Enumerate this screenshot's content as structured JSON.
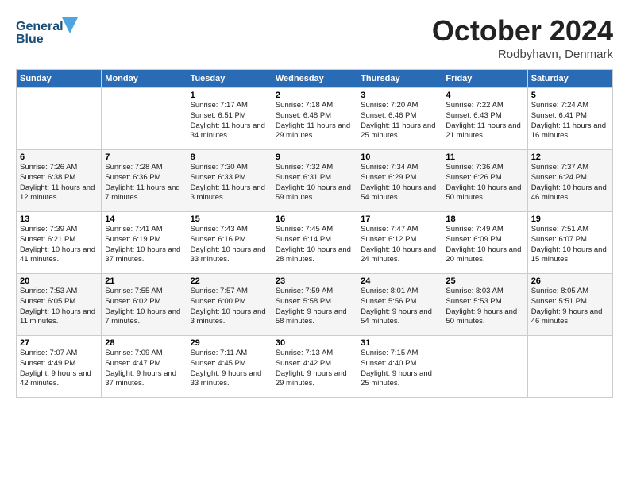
{
  "header": {
    "logo_line1": "General",
    "logo_line2": "Blue",
    "month": "October 2024",
    "location": "Rodbyhavn, Denmark"
  },
  "days_of_week": [
    "Sunday",
    "Monday",
    "Tuesday",
    "Wednesday",
    "Thursday",
    "Friday",
    "Saturday"
  ],
  "weeks": [
    [
      {
        "day": "",
        "sunrise": "",
        "sunset": "",
        "daylight": ""
      },
      {
        "day": "",
        "sunrise": "",
        "sunset": "",
        "daylight": ""
      },
      {
        "day": "1",
        "sunrise": "Sunrise: 7:17 AM",
        "sunset": "Sunset: 6:51 PM",
        "daylight": "Daylight: 11 hours and 34 minutes."
      },
      {
        "day": "2",
        "sunrise": "Sunrise: 7:18 AM",
        "sunset": "Sunset: 6:48 PM",
        "daylight": "Daylight: 11 hours and 29 minutes."
      },
      {
        "day": "3",
        "sunrise": "Sunrise: 7:20 AM",
        "sunset": "Sunset: 6:46 PM",
        "daylight": "Daylight: 11 hours and 25 minutes."
      },
      {
        "day": "4",
        "sunrise": "Sunrise: 7:22 AM",
        "sunset": "Sunset: 6:43 PM",
        "daylight": "Daylight: 11 hours and 21 minutes."
      },
      {
        "day": "5",
        "sunrise": "Sunrise: 7:24 AM",
        "sunset": "Sunset: 6:41 PM",
        "daylight": "Daylight: 11 hours and 16 minutes."
      }
    ],
    [
      {
        "day": "6",
        "sunrise": "Sunrise: 7:26 AM",
        "sunset": "Sunset: 6:38 PM",
        "daylight": "Daylight: 11 hours and 12 minutes."
      },
      {
        "day": "7",
        "sunrise": "Sunrise: 7:28 AM",
        "sunset": "Sunset: 6:36 PM",
        "daylight": "Daylight: 11 hours and 7 minutes."
      },
      {
        "day": "8",
        "sunrise": "Sunrise: 7:30 AM",
        "sunset": "Sunset: 6:33 PM",
        "daylight": "Daylight: 11 hours and 3 minutes."
      },
      {
        "day": "9",
        "sunrise": "Sunrise: 7:32 AM",
        "sunset": "Sunset: 6:31 PM",
        "daylight": "Daylight: 10 hours and 59 minutes."
      },
      {
        "day": "10",
        "sunrise": "Sunrise: 7:34 AM",
        "sunset": "Sunset: 6:29 PM",
        "daylight": "Daylight: 10 hours and 54 minutes."
      },
      {
        "day": "11",
        "sunrise": "Sunrise: 7:36 AM",
        "sunset": "Sunset: 6:26 PM",
        "daylight": "Daylight: 10 hours and 50 minutes."
      },
      {
        "day": "12",
        "sunrise": "Sunrise: 7:37 AM",
        "sunset": "Sunset: 6:24 PM",
        "daylight": "Daylight: 10 hours and 46 minutes."
      }
    ],
    [
      {
        "day": "13",
        "sunrise": "Sunrise: 7:39 AM",
        "sunset": "Sunset: 6:21 PM",
        "daylight": "Daylight: 10 hours and 41 minutes."
      },
      {
        "day": "14",
        "sunrise": "Sunrise: 7:41 AM",
        "sunset": "Sunset: 6:19 PM",
        "daylight": "Daylight: 10 hours and 37 minutes."
      },
      {
        "day": "15",
        "sunrise": "Sunrise: 7:43 AM",
        "sunset": "Sunset: 6:16 PM",
        "daylight": "Daylight: 10 hours and 33 minutes."
      },
      {
        "day": "16",
        "sunrise": "Sunrise: 7:45 AM",
        "sunset": "Sunset: 6:14 PM",
        "daylight": "Daylight: 10 hours and 28 minutes."
      },
      {
        "day": "17",
        "sunrise": "Sunrise: 7:47 AM",
        "sunset": "Sunset: 6:12 PM",
        "daylight": "Daylight: 10 hours and 24 minutes."
      },
      {
        "day": "18",
        "sunrise": "Sunrise: 7:49 AM",
        "sunset": "Sunset: 6:09 PM",
        "daylight": "Daylight: 10 hours and 20 minutes."
      },
      {
        "day": "19",
        "sunrise": "Sunrise: 7:51 AM",
        "sunset": "Sunset: 6:07 PM",
        "daylight": "Daylight: 10 hours and 15 minutes."
      }
    ],
    [
      {
        "day": "20",
        "sunrise": "Sunrise: 7:53 AM",
        "sunset": "Sunset: 6:05 PM",
        "daylight": "Daylight: 10 hours and 11 minutes."
      },
      {
        "day": "21",
        "sunrise": "Sunrise: 7:55 AM",
        "sunset": "Sunset: 6:02 PM",
        "daylight": "Daylight: 10 hours and 7 minutes."
      },
      {
        "day": "22",
        "sunrise": "Sunrise: 7:57 AM",
        "sunset": "Sunset: 6:00 PM",
        "daylight": "Daylight: 10 hours and 3 minutes."
      },
      {
        "day": "23",
        "sunrise": "Sunrise: 7:59 AM",
        "sunset": "Sunset: 5:58 PM",
        "daylight": "Daylight: 9 hours and 58 minutes."
      },
      {
        "day": "24",
        "sunrise": "Sunrise: 8:01 AM",
        "sunset": "Sunset: 5:56 PM",
        "daylight": "Daylight: 9 hours and 54 minutes."
      },
      {
        "day": "25",
        "sunrise": "Sunrise: 8:03 AM",
        "sunset": "Sunset: 5:53 PM",
        "daylight": "Daylight: 9 hours and 50 minutes."
      },
      {
        "day": "26",
        "sunrise": "Sunrise: 8:05 AM",
        "sunset": "Sunset: 5:51 PM",
        "daylight": "Daylight: 9 hours and 46 minutes."
      }
    ],
    [
      {
        "day": "27",
        "sunrise": "Sunrise: 7:07 AM",
        "sunset": "Sunset: 4:49 PM",
        "daylight": "Daylight: 9 hours and 42 minutes."
      },
      {
        "day": "28",
        "sunrise": "Sunrise: 7:09 AM",
        "sunset": "Sunset: 4:47 PM",
        "daylight": "Daylight: 9 hours and 37 minutes."
      },
      {
        "day": "29",
        "sunrise": "Sunrise: 7:11 AM",
        "sunset": "Sunset: 4:45 PM",
        "daylight": "Daylight: 9 hours and 33 minutes."
      },
      {
        "day": "30",
        "sunrise": "Sunrise: 7:13 AM",
        "sunset": "Sunset: 4:42 PM",
        "daylight": "Daylight: 9 hours and 29 minutes."
      },
      {
        "day": "31",
        "sunrise": "Sunrise: 7:15 AM",
        "sunset": "Sunset: 4:40 PM",
        "daylight": "Daylight: 9 hours and 25 minutes."
      },
      {
        "day": "",
        "sunrise": "",
        "sunset": "",
        "daylight": ""
      },
      {
        "day": "",
        "sunrise": "",
        "sunset": "",
        "daylight": ""
      }
    ]
  ]
}
